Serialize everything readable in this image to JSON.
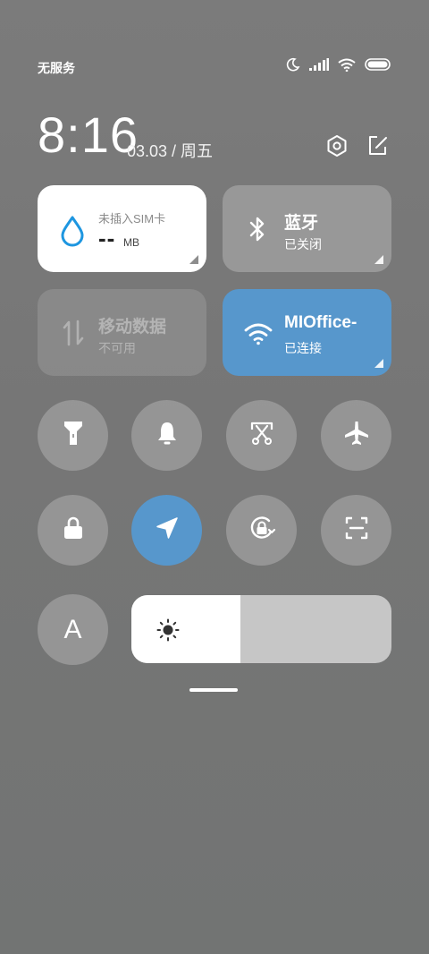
{
  "status_bar": {
    "carrier": "无服务",
    "icons": [
      "moon-icon",
      "signal-icon",
      "wifi-icon",
      "battery-icon"
    ]
  },
  "header": {
    "time": "8:16",
    "date": "03.03 / 周五",
    "icons": [
      "settings-icon",
      "edit-icon"
    ]
  },
  "tiles": {
    "data_usage": {
      "title": "未插入SIM卡",
      "value": "--",
      "unit": "MB"
    },
    "bluetooth": {
      "title": "蓝牙",
      "status": "已关闭"
    },
    "mobile_data": {
      "title": "移动数据",
      "status": "不可用"
    },
    "wifi": {
      "title": "MIOffice-",
      "status": "已连接"
    }
  },
  "toggles": [
    {
      "name": "flashlight",
      "icon": "flashlight-icon",
      "active": false
    },
    {
      "name": "silent",
      "icon": "bell-icon",
      "active": false
    },
    {
      "name": "screenshot",
      "icon": "scissors-icon",
      "active": false
    },
    {
      "name": "airplane-mode",
      "icon": "airplane-icon",
      "active": false
    },
    {
      "name": "lock-screen",
      "icon": "lock-icon",
      "active": false
    },
    {
      "name": "location",
      "icon": "location-arrow-icon",
      "active": true
    },
    {
      "name": "rotation-lock",
      "icon": "rotation-lock-icon",
      "active": false
    },
    {
      "name": "scanner",
      "icon": "scan-icon",
      "active": false
    }
  ],
  "font_toggle": {
    "label": "A"
  },
  "brightness": {
    "level": 0.42,
    "icon": "sun-icon"
  },
  "colors": {
    "accent": "#5797cc",
    "tile_white": "#ffffff",
    "tile_gray": "#9a9a9a",
    "data_icon": "#1e96e0"
  }
}
